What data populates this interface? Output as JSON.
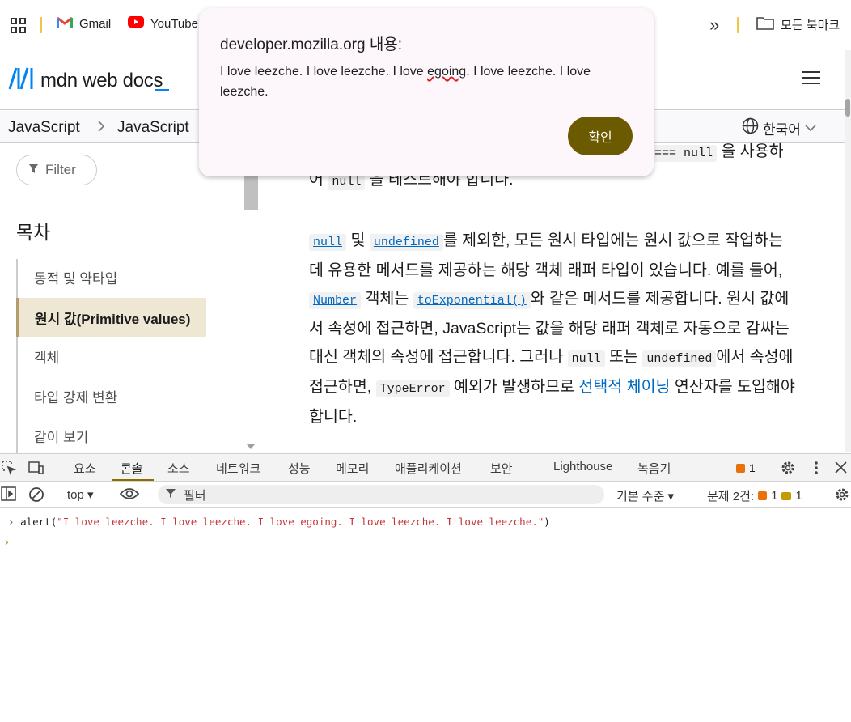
{
  "bookmarks": {
    "items": [
      "Gmail",
      "YouTube"
    ],
    "all_bookmarks": "모든 북마크",
    "more": "»"
  },
  "mdn": {
    "logo": "mdn web docs",
    "breadcrumb": [
      "JavaScript",
      "JavaScript"
    ],
    "language": "한국어"
  },
  "sidebar": {
    "filter_placeholder": "Filter",
    "toc_title": "목차",
    "toc_items": [
      "동적 및 약타입",
      "원시 값(Primitive values)",
      "객체",
      "타입 강제 변환",
      "같이 보기"
    ]
  },
  "content": {
    "p1_tail_code": "=== null",
    "p1_tail_text": "을 사용하",
    "p1_line2_a": "어",
    "p1_line2_code": "null",
    "p1_line2_b": "을 테스트해야 합니다.",
    "p2": {
      "code_null": "null",
      "and": "및",
      "code_undefined": "undefined",
      "t1": "를 제외한, 모든 원시 타입에는 원시 값으로 작업하는 데 유용한 메서드를 제공하는 해당 객체 래퍼 타입이 있습니다. 예를 들어,",
      "code_number": "Number",
      "t2": "객체는",
      "code_toexp": "toExponential()",
      "t3": "와 같은 메서드를 제공합니다. 원시 값에서 속성에 접근하면, JavaScript는 값을 해당 래퍼 객체로 자동으로 감싸는 대신 객체의 속성에 접근합니다. 그러나",
      "code_null2": "null",
      "t4": "또는",
      "code_undefined2": "undefined",
      "t5": "에서 속성에 접근하면,",
      "code_typeerror": "TypeError",
      "t6": "예외가 발생하므로",
      "link_optional": "선택적 체이닝",
      "t7": "연산자를 도입해야 합니다."
    }
  },
  "alert": {
    "title": "developer.mozilla.org 내용:",
    "msg_a": "I love leezche. I love leezche. I love ",
    "msg_misspelled": "egoing",
    "msg_b": ". I love leezche. I love leezche.",
    "ok": "확인"
  },
  "devtools": {
    "tabs": [
      "요소",
      "콘솔",
      "소스",
      "네트워크",
      "성능",
      "메모리",
      "애플리케이션",
      "보안",
      "Lighthouse",
      "녹음기"
    ],
    "issue_count": "1",
    "context": "top ▾",
    "filter_placeholder": "필터",
    "level": "기본 수준 ▾",
    "issues_label": "문제 2건:",
    "issues_error": "1",
    "issues_info": "1",
    "console_cmd": "alert(",
    "console_arg": "\"I love leezche. I love leezche. I love egoing. I love leezche. I love leezche.\"",
    "console_close": ")",
    "colors": {
      "accent": "#8a6d00",
      "string": "#c4343a"
    }
  }
}
